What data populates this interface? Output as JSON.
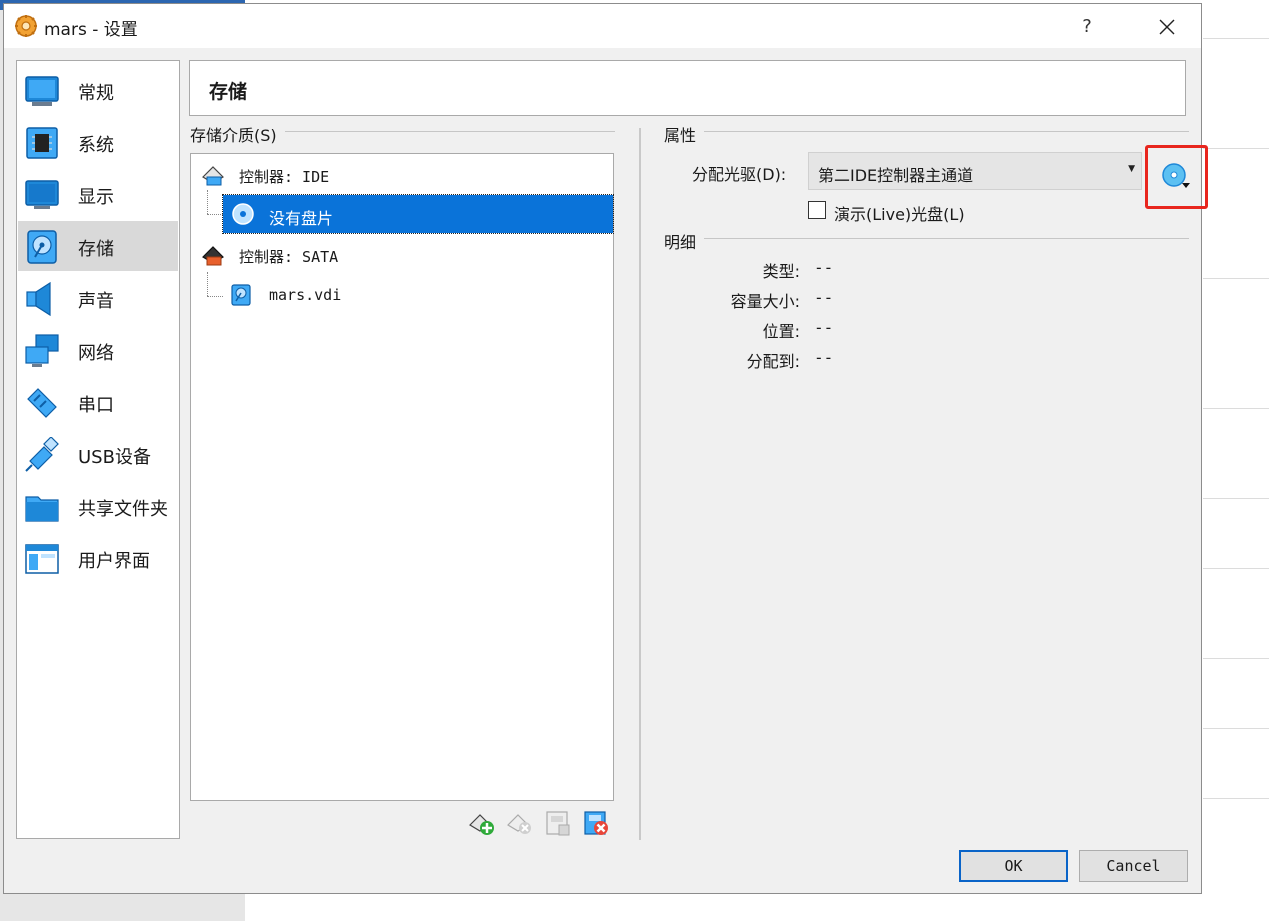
{
  "window": {
    "title": "mars - 设置",
    "help_label": "?"
  },
  "sidebar": {
    "items": [
      {
        "label": "常规",
        "icon": "general-monitor-icon"
      },
      {
        "label": "系统",
        "icon": "system-chip-icon"
      },
      {
        "label": "显示",
        "icon": "display-monitor-icon"
      },
      {
        "label": "存储",
        "icon": "storage-disk-icon",
        "selected": true
      },
      {
        "label": "声音",
        "icon": "speaker-icon"
      },
      {
        "label": "网络",
        "icon": "network-icon"
      },
      {
        "label": "串口",
        "icon": "serial-port-icon"
      },
      {
        "label": "USB设备",
        "icon": "usb-icon"
      },
      {
        "label": "共享文件夹",
        "icon": "shared-folder-icon"
      },
      {
        "label": "用户界面",
        "icon": "user-interface-icon"
      }
    ]
  },
  "page": {
    "title": "存储"
  },
  "storage_media": {
    "group_label": "存储介质(S)",
    "tree": {
      "ide_controller": "控制器: IDE",
      "ide_child": "没有盘片",
      "sata_controller": "控制器: SATA",
      "sata_child": "mars.vdi"
    }
  },
  "attributes": {
    "group_label": "属性",
    "drive_label": "分配光驱(D):",
    "drive_value": "第二IDE控制器主通道",
    "live_cd_label": "演示(Live)光盘(L)",
    "live_cd_checked": false
  },
  "details": {
    "group_label": "明细",
    "rows": [
      {
        "label": "类型:",
        "value": "--"
      },
      {
        "label": "容量大小:",
        "value": "--"
      },
      {
        "label": "位置:",
        "value": "--"
      },
      {
        "label": "分配到:",
        "value": "--"
      }
    ]
  },
  "buttons": {
    "ok": "OK",
    "cancel": "Cancel"
  },
  "colors": {
    "selection": "#0a73d9",
    "highlight_box": "#e8261e",
    "accent_blue": "#1e88d8"
  }
}
